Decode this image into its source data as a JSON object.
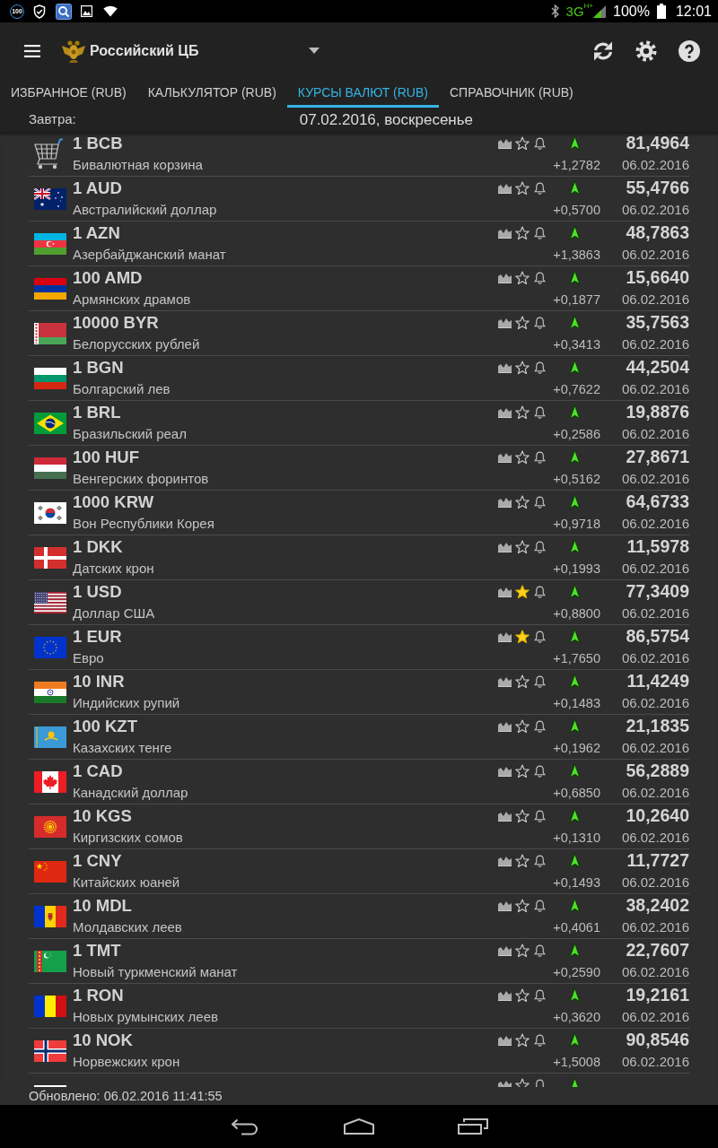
{
  "status_bar": {
    "counter": "100",
    "network": "3G",
    "network_sub": "H+",
    "battery": "100%",
    "time": "12:01"
  },
  "toolbar": {
    "title": "Российский ЦБ"
  },
  "tabs": [
    {
      "label": "ИЗБРАННОЕ (RUB)",
      "selected": false
    },
    {
      "label": "КАЛЬКУЛЯТОР (RUB)",
      "selected": false
    },
    {
      "label": "КУРСЫ ВАЛЮТ (RUB)",
      "selected": true
    },
    {
      "label": "СПРАВОЧНИК (RUB)",
      "selected": false
    }
  ],
  "date_row": {
    "label": "Завтра:",
    "value": "07.02.2016, воскресенье"
  },
  "rates": [
    {
      "code": "1 BCB",
      "name": "Бивалютная корзина",
      "starred": false,
      "rising": true,
      "change": "+1,2782",
      "rate": "81,4964",
      "date": "06.02.2016"
    },
    {
      "code": "1 AUD",
      "name": "Австралийский доллар",
      "starred": false,
      "rising": true,
      "change": "+0,5700",
      "rate": "55,4766",
      "date": "06.02.2016"
    },
    {
      "code": "1 AZN",
      "name": "Азербайджанский манат",
      "starred": false,
      "rising": true,
      "change": "+1,3863",
      "rate": "48,7863",
      "date": "06.02.2016"
    },
    {
      "code": "100 AMD",
      "name": "Армянских драмов",
      "starred": false,
      "rising": true,
      "change": "+0,1877",
      "rate": "15,6640",
      "date": "06.02.2016"
    },
    {
      "code": "10000 BYR",
      "name": "Белорусских рублей",
      "starred": false,
      "rising": true,
      "change": "+0,3413",
      "rate": "35,7563",
      "date": "06.02.2016"
    },
    {
      "code": "1 BGN",
      "name": "Болгарский лев",
      "starred": false,
      "rising": true,
      "change": "+0,7622",
      "rate": "44,2504",
      "date": "06.02.2016"
    },
    {
      "code": "1 BRL",
      "name": "Бразильский реал",
      "starred": false,
      "rising": true,
      "change": "+0,2586",
      "rate": "19,8876",
      "date": "06.02.2016"
    },
    {
      "code": "100 HUF",
      "name": "Венгерских форинтов",
      "starred": false,
      "rising": true,
      "change": "+0,5162",
      "rate": "27,8671",
      "date": "06.02.2016"
    },
    {
      "code": "1000 KRW",
      "name": "Вон Республики Корея",
      "starred": false,
      "rising": true,
      "change": "+0,9718",
      "rate": "64,6733",
      "date": "06.02.2016"
    },
    {
      "code": "1 DKK",
      "name": "Датских крон",
      "starred": false,
      "rising": true,
      "change": "+0,1993",
      "rate": "11,5978",
      "date": "06.02.2016"
    },
    {
      "code": "1 USD",
      "name": "Доллар США",
      "starred": true,
      "rising": true,
      "change": "+0,8800",
      "rate": "77,3409",
      "date": "06.02.2016"
    },
    {
      "code": "1 EUR",
      "name": "Евро",
      "starred": true,
      "rising": true,
      "change": "+1,7650",
      "rate": "86,5754",
      "date": "06.02.2016"
    },
    {
      "code": "10 INR",
      "name": "Индийских рупий",
      "starred": false,
      "rising": true,
      "change": "+0,1483",
      "rate": "11,4249",
      "date": "06.02.2016"
    },
    {
      "code": "100 KZT",
      "name": "Казахских тенге",
      "starred": false,
      "rising": true,
      "change": "+0,1962",
      "rate": "21,1835",
      "date": "06.02.2016"
    },
    {
      "code": "1 CAD",
      "name": "Канадский доллар",
      "starred": false,
      "rising": true,
      "change": "+0,6850",
      "rate": "56,2889",
      "date": "06.02.2016"
    },
    {
      "code": "10 KGS",
      "name": "Киргизских сомов",
      "starred": false,
      "rising": true,
      "change": "+0,1310",
      "rate": "10,2640",
      "date": "06.02.2016"
    },
    {
      "code": "1 CNY",
      "name": "Китайских юаней",
      "starred": false,
      "rising": true,
      "change": "+0,1493",
      "rate": "11,7727",
      "date": "06.02.2016"
    },
    {
      "code": "10 MDL",
      "name": "Молдавских леев",
      "starred": false,
      "rising": true,
      "change": "+0,4061",
      "rate": "38,2402",
      "date": "06.02.2016"
    },
    {
      "code": "1 TMT",
      "name": "Новый туркменский манат",
      "starred": false,
      "rising": true,
      "change": "+0,2590",
      "rate": "22,7607",
      "date": "06.02.2016"
    },
    {
      "code": "1 RON",
      "name": "Новых румынских леев",
      "starred": false,
      "rising": true,
      "change": "+0,3620",
      "rate": "19,2161",
      "date": "06.02.2016"
    },
    {
      "code": "10 NOK",
      "name": "Норвежских крон",
      "starred": false,
      "rising": true,
      "change": "+1,5008",
      "rate": "90,8546",
      "date": "06.02.2016"
    },
    {
      "starred": false,
      "rising": true
    }
  ],
  "footer": {
    "updated": "Обновлено: 06.02.2016 11:41:55"
  }
}
